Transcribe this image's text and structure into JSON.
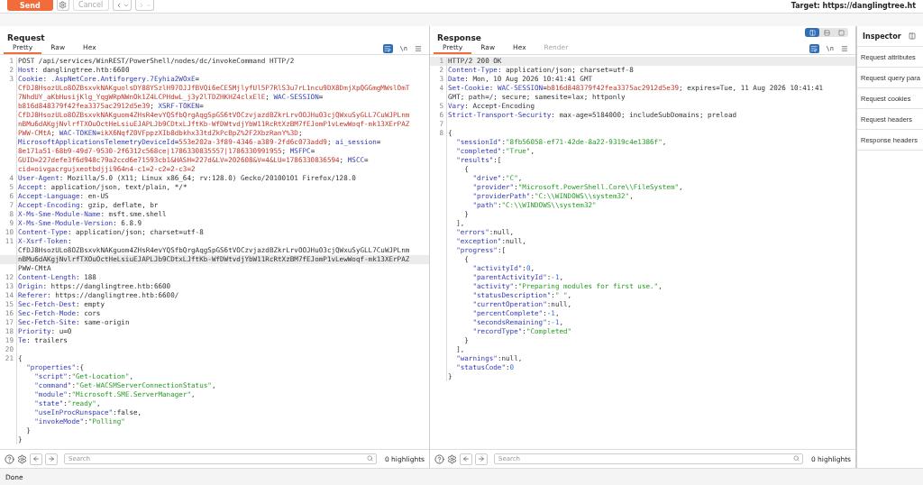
{
  "toolbar": {
    "send": "Send",
    "cancel": {
      "label": "Cancel",
      "disabled": true
    },
    "back": {
      "disabled": false
    },
    "forward": {
      "disabled": true
    },
    "target": "Target: https://danglingtree.ht"
  },
  "panes": [
    {
      "title": "Request",
      "tabs": [
        {
          "label": "Pretty",
          "selected": true,
          "disabled": false
        },
        {
          "label": "Raw",
          "selected": false,
          "disabled": false
        },
        {
          "label": "Hex",
          "selected": false,
          "disabled": false
        }
      ],
      "newline_label": "\\n",
      "search": {
        "placeholder": "Search"
      },
      "highlights": "0 highlights",
      "lines": [
        {
          "number": "1",
          "rows": [
            {
              "tokens": [
                {
                  "kind": "plain",
                  "text": "POST /api/services/WinREST/PowerShell/nodes/dc/invokeCommand HTTP/2"
                }
              ],
              "highlighted": false
            }
          ]
        },
        {
          "number": "2",
          "rows": [
            {
              "tokens": [
                {
                  "kind": "key",
                  "text": "Host"
                },
                {
                  "kind": "plain",
                  "text": ": danglingtree.htb:6600"
                }
              ],
              "highlighted": false
            }
          ]
        },
        {
          "number": "3",
          "rows": [
            {
              "tokens": [
                {
                  "kind": "key",
                  "text": "Cookie"
                },
                {
                  "kind": "plain",
                  "text": ": "
                },
                {
                  "kind": "key",
                  "text": ".AspNetCore.Antiforgery.7Eyhia2WOxE"
                },
                {
                  "kind": "plain",
                  "text": "="
                }
              ],
              "highlighted": false
            },
            {
              "tokens": [
                {
                  "kind": "value",
                  "text": "CfDJ8HsozULo8OZBsxvkNAKguolsDY88YSzlH97OJJfBVQi6eCESMjlyfUl5P7RlS3u7rL1ncu9DX8DmjXpQGGmgMWslOmT"
                }
              ],
              "highlighted": false
            },
            {
              "tokens": [
                {
                  "kind": "value",
                  "text": "7NhdUY_aKbHusijKlg_YqgWRpNWnOk1Z4LCPHdwL_j3y2lTDZHKHZ4clxElE"
                },
                {
                  "kind": "plain",
                  "text": "; "
                },
                {
                  "kind": "key",
                  "text": "WAC-SESSION"
                },
                {
                  "kind": "plain",
                  "text": "="
                }
              ],
              "highlighted": false
            },
            {
              "tokens": [
                {
                  "kind": "value",
                  "text": "b816d848379f42fea3375ac2912d5e39"
                },
                {
                  "kind": "plain",
                  "text": "; "
                },
                {
                  "kind": "key",
                  "text": "XSRF-TOKEN"
                },
                {
                  "kind": "plain",
                  "text": "="
                }
              ],
              "highlighted": false
            },
            {
              "tokens": [
                {
                  "kind": "value",
                  "text": "CfDJ8HsozULo8OZBsxvkNAKguom4ZHsR4evYQSfbQrgAqgSpGS6tVOCzvjazdBZkrLrvOOJHu03cjQWxuSyGLL7CuWJPLnm"
                }
              ],
              "highlighted": false
            },
            {
              "tokens": [
                {
                  "kind": "value",
                  "text": "nBMu6dAKgjNvlrfTXOuOctHeLsiuEJAPLJb9CDtxLJftKb-WfDWtvdjYbW11RcRtXzBM7fEJomP1vLewWoqf-mk13XErPAZ"
                }
              ],
              "highlighted": false
            },
            {
              "tokens": [
                {
                  "kind": "value",
                  "text": "PWW-CMtA"
                },
                {
                  "kind": "plain",
                  "text": "; "
                },
                {
                  "kind": "key",
                  "text": "WAC-TOKEN"
                },
                {
                  "kind": "plain",
                  "text": "="
                },
                {
                  "kind": "value",
                  "text": "ikX6NqfZ0VFppzXIb8dbkhx33tdZkPcBpZ%2F2XbzRanY%3D"
                },
                {
                  "kind": "plain",
                  "text": ";"
                }
              ],
              "highlighted": false
            },
            {
              "tokens": [
                {
                  "kind": "key",
                  "text": "MicrosoftApplicationsTelemetryDeviceId"
                },
                {
                  "kind": "plain",
                  "text": "="
                },
                {
                  "kind": "value",
                  "text": "553e202a-3f89-4346-a389-2fd6c073add9"
                },
                {
                  "kind": "plain",
                  "text": "; "
                },
                {
                  "kind": "key",
                  "text": "ai_session"
                },
                {
                  "kind": "plain",
                  "text": "="
                }
              ],
              "highlighted": false
            },
            {
              "tokens": [
                {
                  "kind": "value",
                  "text": "8e171a51-68b9-49d7-9530-2f6312c568ce|1786330835557|1786330991955"
                },
                {
                  "kind": "plain",
                  "text": "; "
                },
                {
                  "kind": "key",
                  "text": "MSFPC"
                },
                {
                  "kind": "plain",
                  "text": "="
                }
              ],
              "highlighted": false
            },
            {
              "tokens": [
                {
                  "kind": "value",
                  "text": "GUID=227defe3f6d948c79a2ccd6e71593cb1&HASH=227d&LV=202608&V=4&LU=1786330836594"
                },
                {
                  "kind": "plain",
                  "text": "; "
                },
                {
                  "kind": "key",
                  "text": "MSCC"
                },
                {
                  "kind": "plain",
                  "text": "="
                }
              ],
              "highlighted": false
            },
            {
              "tokens": [
                {
                  "kind": "value",
                  "text": "cid=oivgacrgujxeotbdjji964n4-c1=2-c2=2-c3=2"
                }
              ],
              "highlighted": false
            }
          ]
        },
        {
          "number": "4",
          "rows": [
            {
              "tokens": [
                {
                  "kind": "key",
                  "text": "User-Agent"
                },
                {
                  "kind": "plain",
                  "text": ": Mozilla/5.0 (X11; Linux x86_64; rv:128.0) Gecko/20100101 Firefox/128.0"
                }
              ],
              "highlighted": false
            }
          ]
        },
        {
          "number": "5",
          "rows": [
            {
              "tokens": [
                {
                  "kind": "key",
                  "text": "Accept"
                },
                {
                  "kind": "plain",
                  "text": ": application/json, text/plain, */*"
                }
              ],
              "highlighted": false
            }
          ]
        },
        {
          "number": "6",
          "rows": [
            {
              "tokens": [
                {
                  "kind": "key",
                  "text": "Accept-Language"
                },
                {
                  "kind": "plain",
                  "text": ": en-US"
                }
              ],
              "highlighted": false
            }
          ]
        },
        {
          "number": "7",
          "rows": [
            {
              "tokens": [
                {
                  "kind": "key",
                  "text": "Accept-Encoding"
                },
                {
                  "kind": "plain",
                  "text": ": gzip, deflate, br"
                }
              ],
              "highlighted": false
            }
          ]
        },
        {
          "number": "8",
          "rows": [
            {
              "tokens": [
                {
                  "kind": "key",
                  "text": "X-Ms-Sme-Module-Name"
                },
                {
                  "kind": "plain",
                  "text": ": msft.sme.shell"
                }
              ],
              "highlighted": false
            }
          ]
        },
        {
          "number": "9",
          "rows": [
            {
              "tokens": [
                {
                  "kind": "key",
                  "text": "X-Ms-Sme-Module-Version"
                },
                {
                  "kind": "plain",
                  "text": ": 6.8.9"
                }
              ],
              "highlighted": false
            }
          ]
        },
        {
          "number": "10",
          "rows": [
            {
              "tokens": [
                {
                  "kind": "key",
                  "text": "Content-Type"
                },
                {
                  "kind": "plain",
                  "text": ": application/json; charset=utf-8"
                }
              ],
              "highlighted": false
            }
          ]
        },
        {
          "number": "11",
          "rows": [
            {
              "tokens": [
                {
                  "kind": "key",
                  "text": "X-Xsrf-Token"
                },
                {
                  "kind": "plain",
                  "text": ":"
                }
              ],
              "highlighted": false
            },
            {
              "tokens": [
                {
                  "kind": "plain",
                  "text": "CfDJ8HsozULo8OZBsxvkNAKguom4ZHsR4evYQSfbQrgAqgSpGS6tVOCzvjazdBZkrLrvOOJHu03cjQWxuSyGLL7CuWJPLnm"
                }
              ],
              "highlighted": false
            },
            {
              "tokens": [
                {
                  "kind": "plain",
                  "text": "nBMu6dAKgjNvlrfTXOuOctHeLsiuEJAPLJb9CDtxLJftKb-WfDWtvdjYbW11RcRtXzBM7fEJomP1vLewWoqf-mk13XErPAZ"
                }
              ],
              "highlighted": true
            },
            {
              "tokens": [
                {
                  "kind": "plain",
                  "text": "PWW-CMtA"
                }
              ],
              "highlighted": false
            }
          ]
        },
        {
          "number": "12",
          "rows": [
            {
              "tokens": [
                {
                  "kind": "key",
                  "text": "Content-Length"
                },
                {
                  "kind": "plain",
                  "text": ": 188"
                }
              ],
              "highlighted": false
            }
          ]
        },
        {
          "number": "13",
          "rows": [
            {
              "tokens": [
                {
                  "kind": "key",
                  "text": "Origin"
                },
                {
                  "kind": "plain",
                  "text": ": https://danglingtree.htb:6600"
                }
              ],
              "highlighted": false
            }
          ]
        },
        {
          "number": "14",
          "rows": [
            {
              "tokens": [
                {
                  "kind": "key",
                  "text": "Referer"
                },
                {
                  "kind": "plain",
                  "text": ": https://danglingtree.htb:6600/"
                }
              ],
              "highlighted": false
            }
          ]
        },
        {
          "number": "15",
          "rows": [
            {
              "tokens": [
                {
                  "kind": "key",
                  "text": "Sec-Fetch-Dest"
                },
                {
                  "kind": "plain",
                  "text": ": empty"
                }
              ],
              "highlighted": false
            }
          ]
        },
        {
          "number": "16",
          "rows": [
            {
              "tokens": [
                {
                  "kind": "key",
                  "text": "Sec-Fetch-Mode"
                },
                {
                  "kind": "plain",
                  "text": ": cors"
                }
              ],
              "highlighted": false
            }
          ]
        },
        {
          "number": "17",
          "rows": [
            {
              "tokens": [
                {
                  "kind": "key",
                  "text": "Sec-Fetch-Site"
                },
                {
                  "kind": "plain",
                  "text": ": same-origin"
                }
              ],
              "highlighted": false
            }
          ]
        },
        {
          "number": "18",
          "rows": [
            {
              "tokens": [
                {
                  "kind": "key",
                  "text": "Priority"
                },
                {
                  "kind": "plain",
                  "text": ": u=0"
                }
              ],
              "highlighted": false
            }
          ]
        },
        {
          "number": "19",
          "rows": [
            {
              "tokens": [
                {
                  "kind": "key",
                  "text": "Te"
                },
                {
                  "kind": "plain",
                  "text": ": trailers"
                }
              ],
              "highlighted": false
            }
          ]
        },
        {
          "number": "20",
          "rows": [
            {
              "highlighted": false
            }
          ]
        },
        {
          "number": "21",
          "rows": [
            {
              "tokens": [
                {
                  "kind": "plain",
                  "text": "{"
                }
              ],
              "highlighted": false
            },
            {
              "tokens": [
                {
                  "kind": "key",
                  "text": "  \"properties\""
                },
                {
                  "kind": "plain",
                  "text": ":{"
                }
              ],
              "highlighted": false
            },
            {
              "tokens": [
                {
                  "kind": "key",
                  "text": "    \"script\""
                },
                {
                  "kind": "plain",
                  "text": ":"
                },
                {
                  "kind": "string",
                  "text": "\"Get-Location\""
                },
                {
                  "kind": "plain",
                  "text": ","
                }
              ],
              "highlighted": false
            },
            {
              "tokens": [
                {
                  "kind": "key",
                  "text": "    \"command\""
                },
                {
                  "kind": "plain",
                  "text": ":"
                },
                {
                  "kind": "string",
                  "text": "\"Get-WACSMServerConnectionStatus\""
                },
                {
                  "kind": "plain",
                  "text": ","
                }
              ],
              "highlighted": false
            },
            {
              "tokens": [
                {
                  "kind": "key",
                  "text": "    \"module\""
                },
                {
                  "kind": "plain",
                  "text": ":"
                },
                {
                  "kind": "string",
                  "text": "\"Microsoft.SME.ServerManager\""
                },
                {
                  "kind": "plain",
                  "text": ","
                }
              ],
              "highlighted": false
            },
            {
              "tokens": [
                {
                  "kind": "key",
                  "text": "    \"state\""
                },
                {
                  "kind": "plain",
                  "text": ":"
                },
                {
                  "kind": "string",
                  "text": "\"ready\""
                },
                {
                  "kind": "plain",
                  "text": ","
                }
              ],
              "highlighted": false
            },
            {
              "tokens": [
                {
                  "kind": "key",
                  "text": "    \"useInProcRunspace\""
                },
                {
                  "kind": "plain",
                  "text": ":false,"
                }
              ],
              "highlighted": false
            },
            {
              "tokens": [
                {
                  "kind": "key",
                  "text": "    \"invokeMode\""
                },
                {
                  "kind": "plain",
                  "text": ":"
                },
                {
                  "kind": "string",
                  "text": "\"Polling\""
                }
              ],
              "highlighted": false
            },
            {
              "tokens": [
                {
                  "kind": "plain",
                  "text": "  }"
                }
              ],
              "highlighted": false
            },
            {
              "tokens": [
                {
                  "kind": "plain",
                  "text": "}"
                }
              ],
              "highlighted": false
            }
          ]
        }
      ]
    },
    {
      "title": "Response",
      "layout_buttons": [
        {
          "selected": true
        },
        {
          "selected": false
        },
        {
          "selected": false
        }
      ],
      "tabs": [
        {
          "label": "Pretty",
          "selected": true,
          "disabled": false
        },
        {
          "label": "Raw",
          "selected": false,
          "disabled": false
        },
        {
          "label": "Hex",
          "selected": false,
          "disabled": false
        },
        {
          "label": "Render",
          "selected": false,
          "disabled": true
        }
      ],
      "newline_label": "\\n",
      "search": {
        "placeholder": "Search"
      },
      "highlights": "0 highlights",
      "lines": [
        {
          "number": "1",
          "rows": [
            {
              "tokens": [
                {
                  "kind": "plain",
                  "text": "HTTP/2 200 OK"
                }
              ],
              "highlighted": true
            }
          ]
        },
        {
          "number": "2",
          "rows": [
            {
              "tokens": [
                {
                  "kind": "key",
                  "text": "Content-Type"
                },
                {
                  "kind": "plain",
                  "text": ": application/json; charset=utf-8"
                }
              ],
              "highlighted": false
            }
          ]
        },
        {
          "number": "3",
          "rows": [
            {
              "tokens": [
                {
                  "kind": "key",
                  "text": "Date"
                },
                {
                  "kind": "plain",
                  "text": ": Mon, 10 Aug 2026 10:41:41 GMT"
                }
              ],
              "highlighted": false
            }
          ]
        },
        {
          "number": "4",
          "rows": [
            {
              "tokens": [
                {
                  "kind": "key",
                  "text": "Set-Cookie"
                },
                {
                  "kind": "plain",
                  "text": ": "
                },
                {
                  "kind": "key",
                  "text": "WAC-SESSION"
                },
                {
                  "kind": "plain",
                  "text": "="
                },
                {
                  "kind": "value",
                  "text": "b816d848379f42fea3375ac2912d5e39"
                },
                {
                  "kind": "plain",
                  "text": "; expires=Tue, 11 Aug 2026 10:41:41"
                }
              ],
              "highlighted": false
            },
            {
              "tokens": [
                {
                  "kind": "plain",
                  "text": "GMT; path=/; secure; samesite=lax; httponly"
                }
              ],
              "highlighted": false
            }
          ]
        },
        {
          "number": "5",
          "rows": [
            {
              "tokens": [
                {
                  "kind": "key",
                  "text": "Vary"
                },
                {
                  "kind": "plain",
                  "text": ": Accept-Encoding"
                }
              ],
              "highlighted": false
            }
          ]
        },
        {
          "number": "6",
          "rows": [
            {
              "tokens": [
                {
                  "kind": "key",
                  "text": "Strict-Transport-Security"
                },
                {
                  "kind": "plain",
                  "text": ": max-age=5184000; includeSubDomains; preload"
                }
              ],
              "highlighted": false
            }
          ]
        },
        {
          "number": "7",
          "rows": [
            {
              "highlighted": false
            }
          ]
        },
        {
          "number": "8",
          "rows": [
            {
              "tokens": [
                {
                  "kind": "plain",
                  "text": "{"
                }
              ],
              "highlighted": false
            },
            {
              "tokens": [
                {
                  "kind": "key",
                  "text": "  \"sessionId\""
                },
                {
                  "kind": "plain",
                  "text": ":"
                },
                {
                  "kind": "string",
                  "text": "\"8fb56058-ef71-42de-8a22-9319c4e1386f\""
                },
                {
                  "kind": "plain",
                  "text": ","
                }
              ],
              "highlighted": false
            },
            {
              "tokens": [
                {
                  "kind": "key",
                  "text": "  \"completed\""
                },
                {
                  "kind": "plain",
                  "text": ":"
                },
                {
                  "kind": "string",
                  "text": "\"True\""
                },
                {
                  "kind": "plain",
                  "text": ","
                }
              ],
              "highlighted": false
            },
            {
              "tokens": [
                {
                  "kind": "key",
                  "text": "  \"results\""
                },
                {
                  "kind": "plain",
                  "text": ":["
                }
              ],
              "highlighted": false
            },
            {
              "tokens": [
                {
                  "kind": "plain",
                  "text": "    {"
                }
              ],
              "highlighted": false
            },
            {
              "tokens": [
                {
                  "kind": "key",
                  "text": "      \"drive\""
                },
                {
                  "kind": "plain",
                  "text": ":"
                },
                {
                  "kind": "string",
                  "text": "\"C\""
                },
                {
                  "kind": "plain",
                  "text": ","
                }
              ],
              "highlighted": false
            },
            {
              "tokens": [
                {
                  "kind": "key",
                  "text": "      \"provider\""
                },
                {
                  "kind": "plain",
                  "text": ":"
                },
                {
                  "kind": "string",
                  "text": "\"Microsoft.PowerShell.Core\\\\FileSystem\""
                },
                {
                  "kind": "plain",
                  "text": ","
                }
              ],
              "highlighted": false
            },
            {
              "tokens": [
                {
                  "kind": "key",
                  "text": "      \"providerPath\""
                },
                {
                  "kind": "plain",
                  "text": ":"
                },
                {
                  "kind": "string",
                  "text": "\"C:\\\\WINDOWS\\\\system32\""
                },
                {
                  "kind": "plain",
                  "text": ","
                }
              ],
              "highlighted": false
            },
            {
              "tokens": [
                {
                  "kind": "key",
                  "text": "      \"path\""
                },
                {
                  "kind": "plain",
                  "text": ":"
                },
                {
                  "kind": "string",
                  "text": "\"C:\\\\WINDOWS\\\\system32\""
                }
              ],
              "highlighted": false
            },
            {
              "tokens": [
                {
                  "kind": "plain",
                  "text": "    }"
                }
              ],
              "highlighted": false
            },
            {
              "tokens": [
                {
                  "kind": "plain",
                  "text": "  ],"
                }
              ],
              "highlighted": false
            },
            {
              "tokens": [
                {
                  "kind": "key",
                  "text": "  \"errors\""
                },
                {
                  "kind": "plain",
                  "text": ":null,"
                }
              ],
              "highlighted": false
            },
            {
              "tokens": [
                {
                  "kind": "key",
                  "text": "  \"exception\""
                },
                {
                  "kind": "plain",
                  "text": ":null,"
                }
              ],
              "highlighted": false
            },
            {
              "tokens": [
                {
                  "kind": "key",
                  "text": "  \"progress\""
                },
                {
                  "kind": "plain",
                  "text": ":["
                }
              ],
              "highlighted": false
            },
            {
              "tokens": [
                {
                  "kind": "plain",
                  "text": "    {"
                }
              ],
              "highlighted": false
            },
            {
              "tokens": [
                {
                  "kind": "key",
                  "text": "      \"activityId\""
                },
                {
                  "kind": "plain",
                  "text": ":"
                },
                {
                  "kind": "number",
                  "text": "0"
                },
                {
                  "kind": "plain",
                  "text": ","
                }
              ],
              "highlighted": false
            },
            {
              "tokens": [
                {
                  "kind": "key",
                  "text": "      \"parentActivityId\""
                },
                {
                  "kind": "plain",
                  "text": ":"
                },
                {
                  "kind": "number",
                  "text": "-1"
                },
                {
                  "kind": "plain",
                  "text": ","
                }
              ],
              "highlighted": false
            },
            {
              "tokens": [
                {
                  "kind": "key",
                  "text": "      \"activity\""
                },
                {
                  "kind": "plain",
                  "text": ":"
                },
                {
                  "kind": "string",
                  "text": "\"Preparing modules for first use.\""
                },
                {
                  "kind": "plain",
                  "text": ","
                }
              ],
              "highlighted": false
            },
            {
              "tokens": [
                {
                  "kind": "key",
                  "text": "      \"statusDescription\""
                },
                {
                  "kind": "plain",
                  "text": ":"
                },
                {
                  "kind": "string",
                  "text": "\" \""
                },
                {
                  "kind": "plain",
                  "text": ","
                }
              ],
              "highlighted": false
            },
            {
              "tokens": [
                {
                  "kind": "key",
                  "text": "      \"currentOperation\""
                },
                {
                  "kind": "plain",
                  "text": ":null,"
                }
              ],
              "highlighted": false
            },
            {
              "tokens": [
                {
                  "kind": "key",
                  "text": "      \"percentComplete\""
                },
                {
                  "kind": "plain",
                  "text": ":"
                },
                {
                  "kind": "number",
                  "text": "-1"
                },
                {
                  "kind": "plain",
                  "text": ","
                }
              ],
              "highlighted": false
            },
            {
              "tokens": [
                {
                  "kind": "key",
                  "text": "      \"secondsRemaining\""
                },
                {
                  "kind": "plain",
                  "text": ":"
                },
                {
                  "kind": "number",
                  "text": "-1"
                },
                {
                  "kind": "plain",
                  "text": ","
                }
              ],
              "highlighted": false
            },
            {
              "tokens": [
                {
                  "kind": "key",
                  "text": "      \"recordType\""
                },
                {
                  "kind": "plain",
                  "text": ":"
                },
                {
                  "kind": "string",
                  "text": "\"Completed\""
                }
              ],
              "highlighted": false
            },
            {
              "tokens": [
                {
                  "kind": "plain",
                  "text": "    }"
                }
              ],
              "highlighted": false
            },
            {
              "tokens": [
                {
                  "kind": "plain",
                  "text": "  ],"
                }
              ],
              "highlighted": false
            },
            {
              "tokens": [
                {
                  "kind": "key",
                  "text": "  \"warnings\""
                },
                {
                  "kind": "plain",
                  "text": ":null,"
                }
              ],
              "highlighted": false
            },
            {
              "tokens": [
                {
                  "kind": "key",
                  "text": "  \"statusCode\""
                },
                {
                  "kind": "plain",
                  "text": ":"
                },
                {
                  "kind": "number",
                  "text": "0"
                }
              ],
              "highlighted": false
            },
            {
              "tokens": [
                {
                  "kind": "plain",
                  "text": "}"
                }
              ],
              "highlighted": false
            }
          ]
        }
      ]
    }
  ],
  "inspector": {
    "title": "Inspector",
    "items": [
      "Request attributes",
      "Request query para",
      "Request cookies",
      "Request headers",
      "Response headers"
    ]
  },
  "status_bar": "Done"
}
